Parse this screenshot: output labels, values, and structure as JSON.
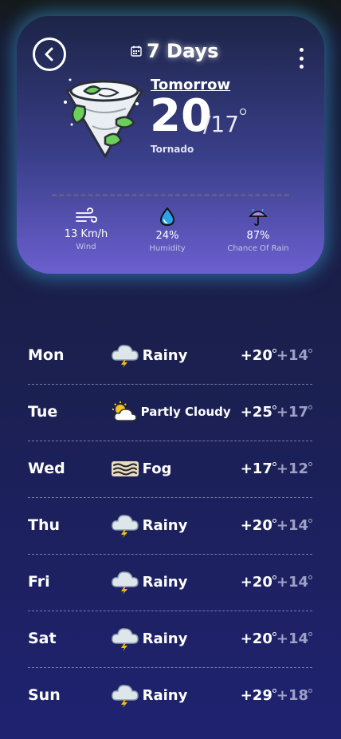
{
  "header": {
    "title": "7 Days",
    "back_icon": "chevron-left-icon",
    "calendar_icon": "calendar-icon",
    "more_icon": "more-vertical-icon"
  },
  "hero": {
    "day_label": "Tomorrow",
    "temp_high": "20",
    "temp_low": "/17",
    "condition": "Tornado",
    "icon": "tornado-icon"
  },
  "stats": [
    {
      "value": "13 Km/h",
      "label": "Wind",
      "icon": "wind-icon"
    },
    {
      "value": "24%",
      "label": "Humidity",
      "icon": "water-drop-icon"
    },
    {
      "value": "87%",
      "label": "Chance Of Rain",
      "icon": "umbrella-icon"
    }
  ],
  "forecast": [
    {
      "day": "Mon",
      "condition": "Rainy",
      "icon": "storm-cloud-icon",
      "high": "+20",
      "low": "+14"
    },
    {
      "day": "Tue",
      "condition": "Partly Cloudy",
      "icon": "partly-cloudy-icon",
      "high": "+25",
      "low": "+17"
    },
    {
      "day": "Wed",
      "condition": "Fog",
      "icon": "fog-icon",
      "high": "+17",
      "low": "+12"
    },
    {
      "day": "Thu",
      "condition": "Rainy",
      "icon": "storm-cloud-icon",
      "high": "+20",
      "low": "+14"
    },
    {
      "day": "Fri",
      "condition": "Rainy",
      "icon": "storm-cloud-icon",
      "high": "+20",
      "low": "+14"
    },
    {
      "day": "Sat",
      "condition": "Rainy",
      "icon": "storm-cloud-icon",
      "high": "+20",
      "low": "+14"
    },
    {
      "day": "Sun",
      "condition": "Rainy",
      "icon": "storm-cloud-icon",
      "high": "+29",
      "low": "+18"
    }
  ]
}
